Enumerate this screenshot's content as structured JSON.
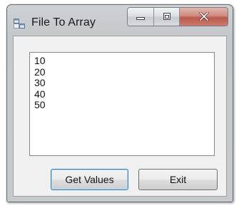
{
  "window": {
    "title": "File To Array",
    "icon": "windows-form-icon"
  },
  "caption_buttons": {
    "minimize_icon": "minimize-icon",
    "maximize_icon": "maximize-icon",
    "close_icon": "close-icon"
  },
  "listbox": {
    "items": [
      "10",
      "20",
      "30",
      "40",
      "50"
    ]
  },
  "buttons": {
    "get_values_label": "Get Values",
    "exit_label": "Exit"
  },
  "colors": {
    "close_button": "#c0685b",
    "focus_border": "#3c7fb1"
  }
}
